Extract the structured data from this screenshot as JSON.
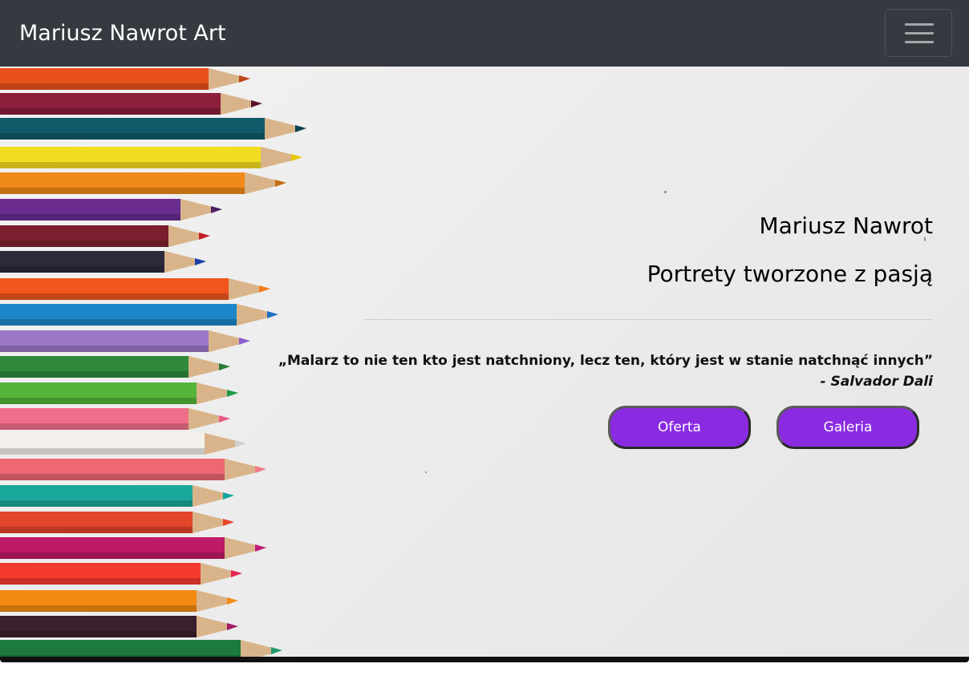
{
  "navbar": {
    "brand": "Mariusz Nawrot Art",
    "toggle_icon": "hamburger-menu-icon",
    "background": "#343a40"
  },
  "hero": {
    "name": "Mariusz Nawrot",
    "tagline": "Portrety tworzone z pasją",
    "quote": "„Malarz to nie ten kto jest natchniony, lecz ten, który jest w stanie natchnąć innych”",
    "author": "- Salvador Dali",
    "buttons": {
      "offer_label": "Oferta",
      "gallery_label": "Galeria",
      "color": "#8a2be2"
    },
    "image": "colored-pencils-photo"
  }
}
